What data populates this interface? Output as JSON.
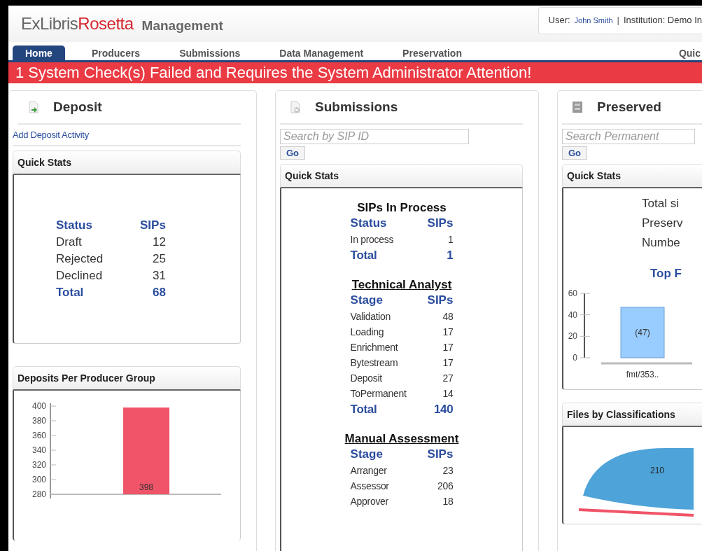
{
  "header": {
    "logo_ex": "ExLibris",
    "logo_product": "Rosetta",
    "app_name": "Management",
    "user_label": "User:",
    "user_name": "John Smith",
    "separator": "|",
    "institution": "Institution: Demo In"
  },
  "nav": {
    "tabs": [
      {
        "label": "Home",
        "selected": true
      },
      {
        "label": "Producers",
        "selected": false
      },
      {
        "label": "Submissions",
        "selected": false
      },
      {
        "label": "Data Management",
        "selected": false
      },
      {
        "label": "Preservation",
        "selected": false
      }
    ],
    "quick_link": "Quic"
  },
  "alert": "1 System Check(s) Failed and Requires the System Administrator Attention!",
  "deposit": {
    "title": "Deposit",
    "link": "Add Deposit Activity",
    "quick_stats": {
      "title": "Quick Stats",
      "columns": [
        "Status",
        "SIPs"
      ],
      "rows": [
        {
          "label": "Draft",
          "value": "12"
        },
        {
          "label": "Rejected",
          "value": "25"
        },
        {
          "label": "Declined",
          "value": "31"
        }
      ],
      "total": {
        "label": "Total",
        "value": "68"
      }
    },
    "producer_chart": {
      "title": "Deposits Per Producer Group",
      "chart_data": {
        "type": "bar",
        "categories": [
          null
        ],
        "ylim": [
          280,
          400
        ],
        "yticks": [
          280,
          300,
          320,
          340,
          360,
          380,
          400
        ],
        "data_labels": true,
        "series": [
          {
            "color": "#f05468",
            "values": [
              398
            ]
          }
        ]
      }
    }
  },
  "submissions": {
    "title": "Submissions",
    "search_placeholder": "Search by SIP ID",
    "go_button": "Go",
    "quick_stats_title": "Quick Stats",
    "sections": [
      {
        "title": "SIPs In Process",
        "underlined": false,
        "columns": [
          "Status",
          "SIPs"
        ],
        "rows": [
          {
            "label": "In process",
            "value": "1"
          }
        ],
        "total": {
          "label": "Total",
          "value": "1"
        }
      },
      {
        "title": "Technical Analyst",
        "underlined": true,
        "columns": [
          "Stage",
          "SIPs"
        ],
        "rows": [
          {
            "label": "Validation",
            "value": "48"
          },
          {
            "label": "Loading",
            "value": "17"
          },
          {
            "label": "Enrichment",
            "value": "17"
          },
          {
            "label": "Bytestream",
            "value": "17"
          },
          {
            "label": "Deposit",
            "value": "27"
          },
          {
            "label": "ToPermanent",
            "value": "14"
          }
        ],
        "total": {
          "label": "Total",
          "value": "140"
        }
      },
      {
        "title": "Manual Assessment",
        "underlined": true,
        "columns": [
          "Stage",
          "SIPs"
        ],
        "rows": [
          {
            "label": "Arranger",
            "value": "23"
          },
          {
            "label": "Assessor",
            "value": "206"
          },
          {
            "label": "Approver",
            "value": "18"
          }
        ]
      }
    ]
  },
  "preserved": {
    "title": "Preserved",
    "search_placeholder": "Search Permanent",
    "go_button": "Go",
    "quick_stats_title": "Quick Stats",
    "stats_lines": [
      "Total si",
      "Preserv",
      "Numbe"
    ],
    "chart_title": "Top F",
    "chart_data": {
      "type": "bar",
      "categories": [
        "fmt/353.."
      ],
      "ylim": [
        0,
        60
      ],
      "yticks": [
        0,
        20,
        40,
        60
      ],
      "value_labels": [
        "(47)"
      ],
      "series": [
        {
          "color": "#99ccff",
          "values": [
            47
          ]
        }
      ]
    },
    "classifications": {
      "title": "Files by Classifications",
      "slice_label": "210"
    }
  }
}
